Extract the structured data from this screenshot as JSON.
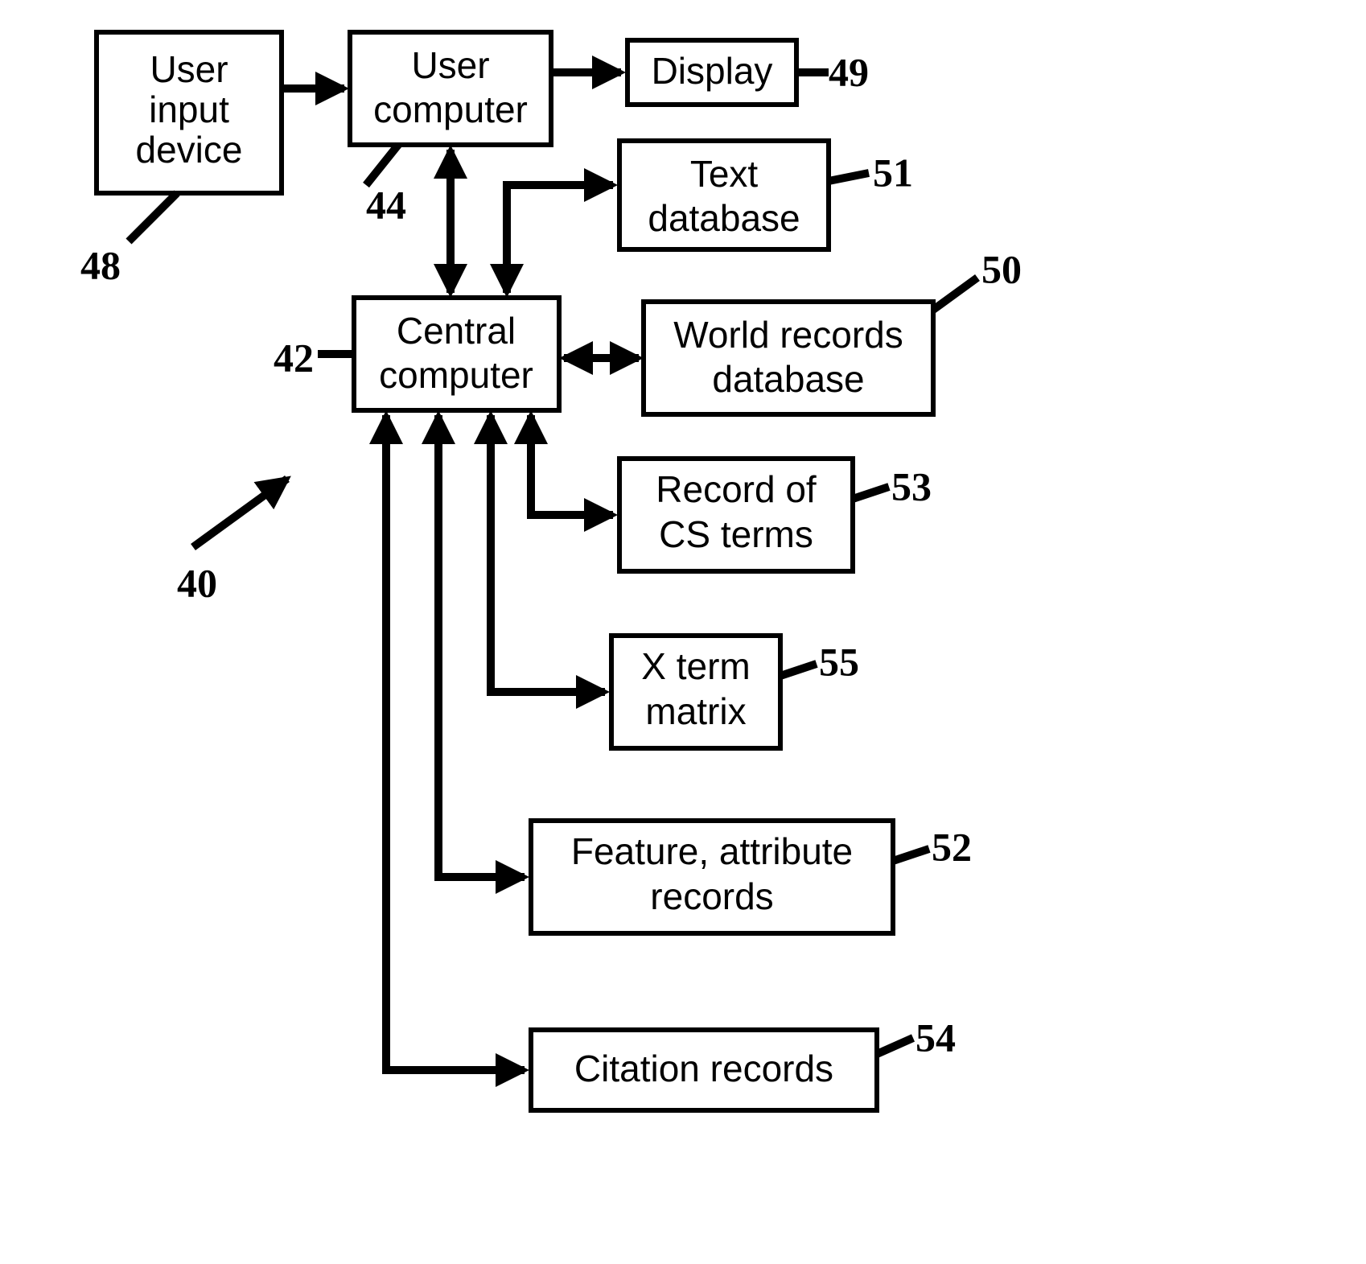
{
  "diagram": {
    "system_ref": "40",
    "nodes": {
      "user_input_device": {
        "label_l1": "User",
        "label_l2": "input",
        "label_l3": "device",
        "ref": "48"
      },
      "user_computer": {
        "label_l1": "User",
        "label_l2": "computer",
        "ref": "44"
      },
      "display": {
        "label": "Display",
        "ref": "49"
      },
      "text_database": {
        "label_l1": "Text",
        "label_l2": "database",
        "ref": "51"
      },
      "central_computer": {
        "label_l1": "Central",
        "label_l2": "computer",
        "ref": "42"
      },
      "world_records_db": {
        "label_l1": "World records",
        "label_l2": "database",
        "ref": "50"
      },
      "record_cs_terms": {
        "label_l1": "Record of",
        "label_l2": "CS terms",
        "ref": "53"
      },
      "x_term_matrix": {
        "label_l1": "X term",
        "label_l2": "matrix",
        "ref": "55"
      },
      "feature_attribute": {
        "label_l1": "Feature, attribute",
        "label_l2": "records",
        "ref": "52"
      },
      "citation_records": {
        "label": "Citation records",
        "ref": "54"
      }
    },
    "edge_labels": {}
  }
}
